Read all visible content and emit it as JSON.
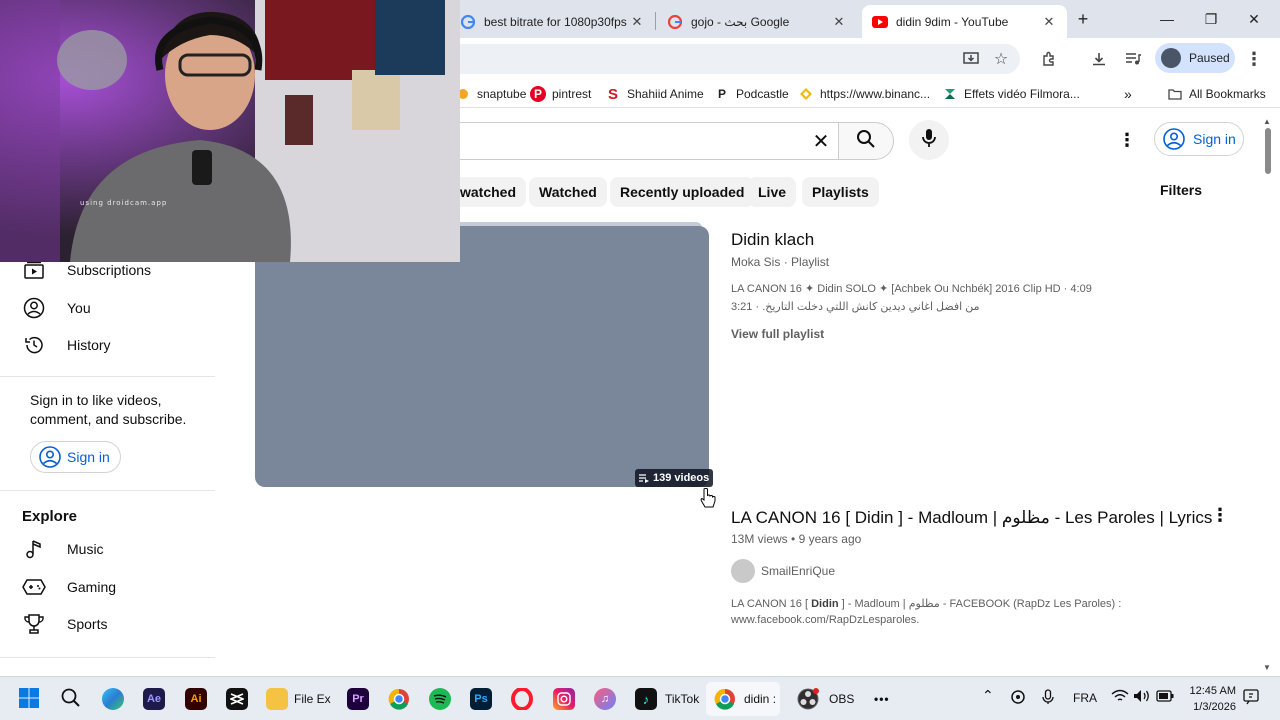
{
  "browser": {
    "tabs": [
      {
        "title": "best bitrate for 1080p30fps",
        "favicon": "google-g-icon",
        "active": false
      },
      {
        "title": "gojo - بحث Google",
        "favicon": "google-g-icon",
        "active": false
      },
      {
        "title": "didin 9dim - YouTube",
        "favicon": "youtube-icon",
        "active": true
      }
    ],
    "new_tab": "+",
    "profile_label": "Paused",
    "bookmarks": [
      {
        "label": "snaptube",
        "icon": "snaptube-icon"
      },
      {
        "label": "pintrest",
        "icon": "pinterest-icon"
      },
      {
        "label": "Shahiid Anime",
        "icon": "shahid-icon"
      },
      {
        "label": "Podcastle",
        "icon": "podcastle-icon"
      },
      {
        "label": "https://www.binanc...",
        "icon": "binance-icon"
      },
      {
        "label": "Effets vidéo Filmora...",
        "icon": "filmora-icon"
      }
    ],
    "all_bookmarks": "All Bookmarks"
  },
  "youtube": {
    "signin_label": "Sign in",
    "chips": [
      "watched",
      "Watched",
      "Recently uploaded",
      "Live",
      "Playlists"
    ],
    "filters_label": "Filters",
    "sidebar": {
      "items_top": [
        {
          "label": "Subscriptions",
          "icon": "subscriptions-icon"
        },
        {
          "label": "You",
          "icon": "you-icon"
        },
        {
          "label": "History",
          "icon": "history-icon"
        }
      ],
      "signin_prompt": "Sign in to like videos, comment, and subscribe.",
      "signin_label": "Sign in",
      "explore_title": "Explore",
      "explore_items": [
        {
          "label": "Music",
          "icon": "music-icon"
        },
        {
          "label": "Gaming",
          "icon": "gaming-icon"
        },
        {
          "label": "Sports",
          "icon": "sports-icon"
        }
      ]
    },
    "playlist": {
      "title": "Didin klach",
      "channel": "Moka Sis",
      "type": "Playlist",
      "item1": "LA CANON 16 ✦ Didin SOLO ✦ [Achbek Ou Nchbék] 2016 Clip HD · 4:09",
      "item2": "من افضل اغاني ديدين كانش اللتي دخلت التاريخ. · 3:21",
      "view_full": "View full playlist",
      "video_count": "139 videos"
    },
    "video": {
      "title": "LA CANON 16 [ Didin ] - Madloum | مظلوم - Les Paroles | Lyrics",
      "views": "13M views",
      "age": "9 years ago",
      "channel": "SmailEnriQue",
      "desc_line1_pre": "LA CANON 16 [ ",
      "desc_line1_bold": "Didin",
      "desc_line1_post": " ] - Madloum | مظلوم - FACEBOOK (RapDz Les Paroles) :",
      "desc_line2": "www.facebook.com/RapDzLesparoles."
    }
  },
  "webcam": {
    "watermark": "using droidcam.app"
  },
  "taskbar": {
    "apps": [
      {
        "label": "",
        "icon": "windows-start-icon"
      },
      {
        "label": "",
        "icon": "search-icon"
      },
      {
        "label": "",
        "icon": "edge-icon"
      },
      {
        "label": "Ae",
        "icon": "after-effects-icon"
      },
      {
        "label": "Ai",
        "icon": "illustrator-icon"
      },
      {
        "label": "",
        "icon": "capcut-icon"
      },
      {
        "label": "File Ex",
        "icon": "file-explorer-icon"
      },
      {
        "label": "Pr",
        "icon": "premiere-icon"
      },
      {
        "label": "",
        "icon": "chrome-icon"
      },
      {
        "label": "",
        "icon": "spotify-icon"
      },
      {
        "label": "Ps",
        "icon": "photoshop-icon"
      },
      {
        "label": "",
        "icon": "opera-icon"
      },
      {
        "label": "",
        "icon": "instagram-icon"
      },
      {
        "label": "",
        "icon": "itunes-icon"
      },
      {
        "label": "TikTok",
        "icon": "tiktok-icon"
      },
      {
        "label": "didin :",
        "icon": "chrome-icon"
      },
      {
        "label": "OBS",
        "icon": "obs-icon"
      }
    ],
    "more": "•••",
    "lang": "FRA",
    "time": "12:45 AM",
    "date": "1/3/2026"
  },
  "colors": {
    "accent_blue": "#065fd4",
    "youtube_red": "#ff0000",
    "thumb": "#7a879a"
  }
}
